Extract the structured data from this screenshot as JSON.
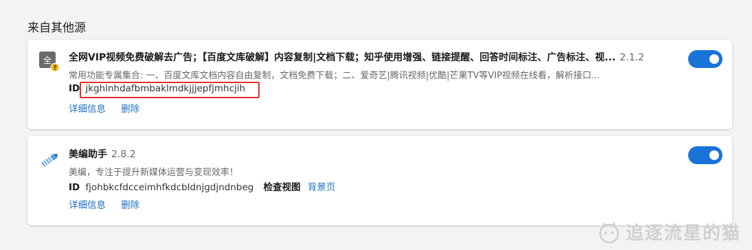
{
  "section": {
    "title": "来自其他源"
  },
  "extensions": [
    {
      "title": "全网VIP视频免费破解去广告；【百度文库破解】内容复制|文档下载；知乎使用增强、链接提醒、回答时间标注、广告标注、视...",
      "version": "2.1.2",
      "description": "常用功能专属集合: 一、百度文库文档内容自由复制，文档免费下载；二、爱奇艺|腾讯视频|优酷|芒果TV等VIP视频在线看，解析接口...",
      "id_label": "ID",
      "id": "jkghlnhdafbmbaklmdkjjjepfjmhcjih",
      "details_link": "详细信息",
      "remove_link": "删除",
      "enabled": true,
      "icon": "script-extension-icon"
    },
    {
      "title": "美编助手",
      "version": "2.8.2",
      "description": "美编，专注于提升新媒体运营与变现效率！",
      "id_label": "ID",
      "id": "fjohbkcfdcceimhfkdcbldnjgdjndnbeg",
      "inspect_label": "检查视图",
      "background_page_link": "背景页",
      "details_link": "详细信息",
      "remove_link": "删除",
      "enabled": true,
      "icon": "pen-icon"
    }
  ],
  "watermark": {
    "text": "追逐流星的猫"
  }
}
